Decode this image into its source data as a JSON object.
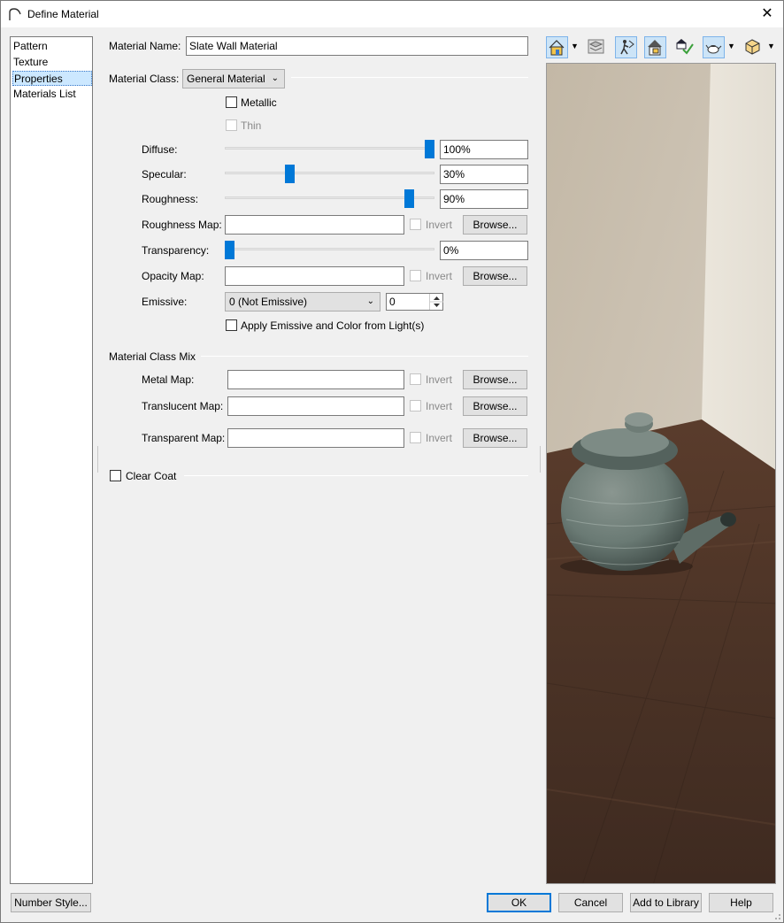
{
  "window": {
    "title": "Define Material",
    "close_glyph": "✕"
  },
  "nav": {
    "items": [
      {
        "label": "Pattern",
        "selected": false
      },
      {
        "label": "Texture",
        "selected": false
      },
      {
        "label": "Properties",
        "selected": true
      },
      {
        "label": "Materials List",
        "selected": false
      }
    ]
  },
  "form": {
    "material_name_label": "Material Name:",
    "material_name_value": "Slate Wall Material",
    "material_class_label": "Material Class:",
    "material_class_value": "General Material",
    "metallic_label": "Metallic",
    "metallic_checked": false,
    "thin_label": "Thin",
    "thin_checked": false,
    "diffuse_label": "Diffuse:",
    "diffuse_value": "100%",
    "diffuse_level": 1.0,
    "specular_label": "Specular:",
    "specular_value": "30%",
    "specular_level": 0.3,
    "roughness_label": "Roughness:",
    "roughness_value": "90%",
    "roughness_level": 0.9,
    "roughness_map_label": "Roughness Map:",
    "roughness_map_value": "",
    "transparency_label": "Transparency:",
    "transparency_value": "0%",
    "transparency_level": 0.0,
    "opacity_map_label": "Opacity Map:",
    "opacity_map_value": "",
    "invert_label": "Invert",
    "browse_label": "Browse...",
    "emissive_label": "Emissive:",
    "emissive_value": "0 (Not Emissive)",
    "emissive_number": "0",
    "apply_emissive_label": "Apply Emissive and Color from Light(s)",
    "apply_emissive_checked": false
  },
  "mix": {
    "section_label": "Material Class Mix",
    "metal_map_label": "Metal Map:",
    "metal_map_value": "",
    "translucent_map_label": "Translucent Map:",
    "translucent_map_value": "",
    "transparent_map_label": "Transparent Map:",
    "transparent_map_value": ""
  },
  "clear_coat": {
    "label": "Clear Coat",
    "checked": false
  },
  "toolbar": {
    "icons": [
      "house-render-icon",
      "layers-icon",
      "walkthrough-icon",
      "house-check-icon",
      "material-check-icon",
      "teapot-icon",
      "box-3d-icon"
    ]
  },
  "footer": {
    "number_style_label": "Number Style...",
    "ok_label": "OK",
    "cancel_label": "Cancel",
    "add_library_label": "Add to Library",
    "help_label": "Help"
  },
  "colors": {
    "accent": "#0078d7",
    "selection": "#cce8ff"
  }
}
